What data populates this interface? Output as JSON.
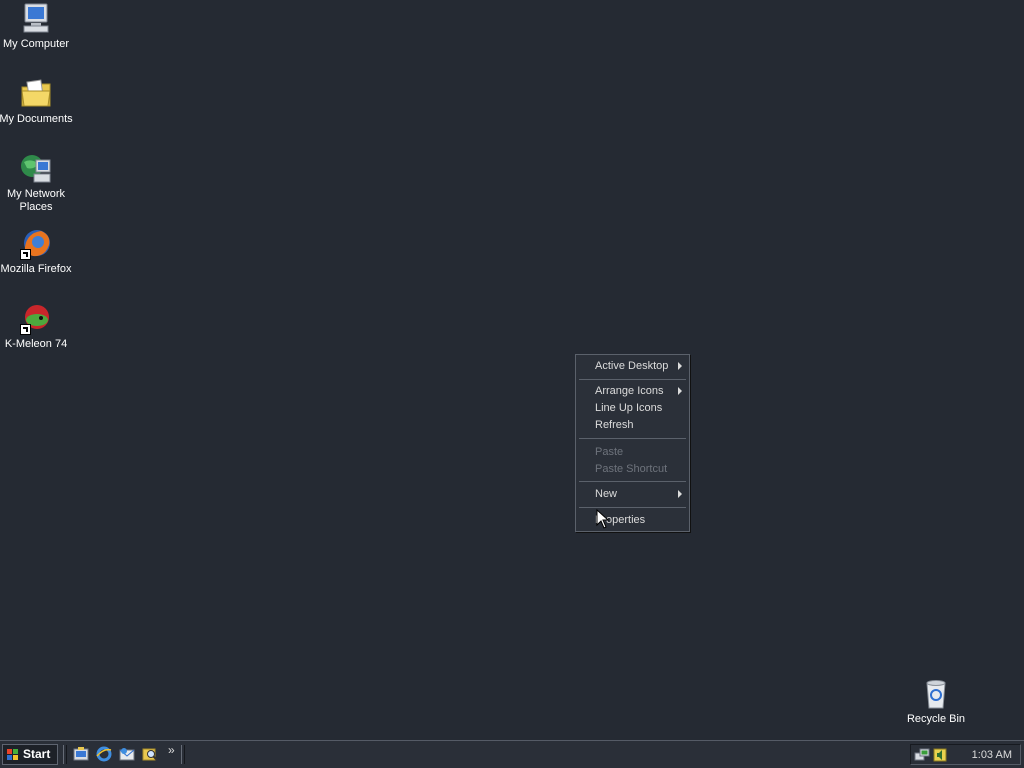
{
  "desktop": {
    "icons": [
      {
        "label": "My Computer",
        "icon": "computer-icon"
      },
      {
        "label": "My Documents",
        "icon": "folder-documents-icon"
      },
      {
        "label": "My Network Places",
        "icon": "network-places-icon"
      },
      {
        "label": "Mozilla Firefox",
        "icon": "firefox-icon"
      },
      {
        "label": "K-Meleon 74",
        "icon": "kmeleon-icon"
      },
      {
        "label": "Recycle Bin",
        "icon": "recycle-bin-icon"
      }
    ]
  },
  "context_menu": {
    "items": [
      {
        "label": "Active Desktop",
        "submenu": true,
        "enabled": true
      },
      {
        "label": "Arrange Icons",
        "submenu": true,
        "enabled": true
      },
      {
        "label": "Line Up Icons",
        "enabled": true
      },
      {
        "label": "Refresh",
        "enabled": true
      },
      {
        "label": "Paste",
        "enabled": false
      },
      {
        "label": "Paste Shortcut",
        "enabled": false
      },
      {
        "label": "New",
        "submenu": true,
        "enabled": true
      },
      {
        "label": "Properties",
        "enabled": true
      }
    ]
  },
  "taskbar": {
    "start_label": "Start",
    "quick_launch": [
      "show-desktop-icon",
      "internet-explorer-icon",
      "outlook-express-icon",
      "search-icon"
    ],
    "overflow_label": "»",
    "tray_icons": [
      "network-tray-icon",
      "volume-tray-icon"
    ],
    "clock": "1:03 AM"
  }
}
